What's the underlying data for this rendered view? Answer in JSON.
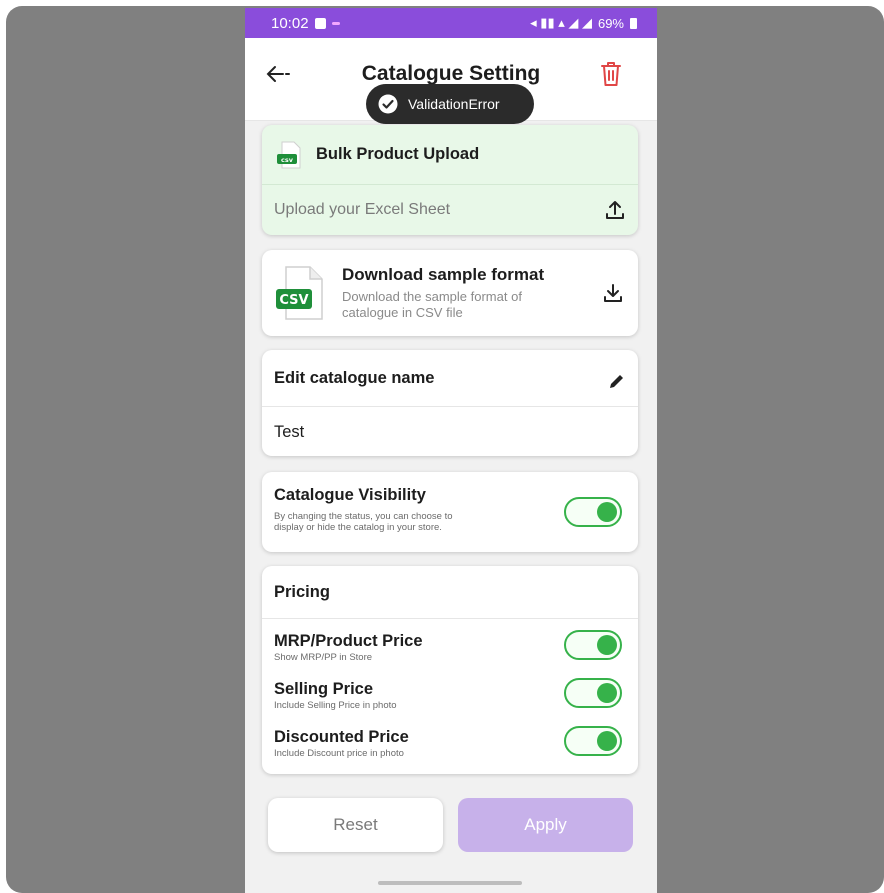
{
  "status_bar": {
    "time": "10:02",
    "battery": "69%"
  },
  "header": {
    "title": "Catalogue Setting"
  },
  "toast": {
    "message": "ValidationError"
  },
  "bulk_upload": {
    "title": "Bulk Product Upload",
    "upload_placeholder": "Upload your Excel Sheet",
    "icon_text": "csv"
  },
  "download_sample": {
    "title": "Download sample format",
    "description_line1": "Download the sample format of",
    "description_line2": "catalogue in CSV file",
    "icon_text": "CSV"
  },
  "edit_name": {
    "label": "Edit catalogue name",
    "value": "Test"
  },
  "visibility": {
    "title": "Catalogue Visibility",
    "description_line1": "By changing the status, you can choose to",
    "description_line2": "display or hide the catalog in your store.",
    "enabled": true
  },
  "pricing": {
    "header": "Pricing",
    "items": [
      {
        "title": "MRP/Product Price",
        "subtitle": "Show MRP/PP in Store",
        "enabled": true
      },
      {
        "title": "Selling Price",
        "subtitle": "Include Selling Price in photo",
        "enabled": true
      },
      {
        "title": "Discounted Price",
        "subtitle": "Include Discount price in photo",
        "enabled": true
      }
    ]
  },
  "buttons": {
    "reset": "Reset",
    "apply": "Apply"
  },
  "colors": {
    "brand_purple": "#8a4ddb",
    "toggle_green": "#36b24a",
    "apply_disabled": "#c7b1ea",
    "delete_red": "#e04646"
  }
}
